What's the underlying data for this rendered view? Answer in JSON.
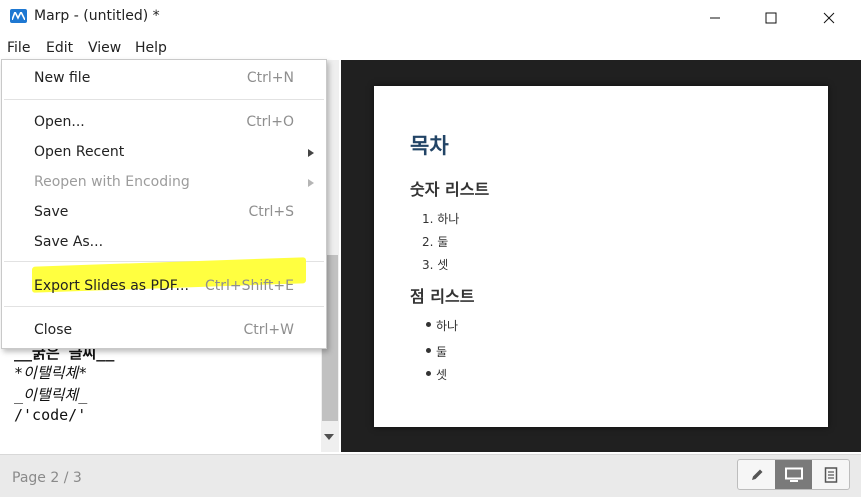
{
  "window": {
    "title": "Marp - (untitled) *",
    "icon": "marp-logo-icon"
  },
  "menubar": {
    "items": [
      "File",
      "Edit",
      "View",
      "Help"
    ]
  },
  "file_menu": {
    "items": [
      {
        "label": "New file",
        "shortcut": "Ctrl+N"
      },
      {
        "label": "Open...",
        "shortcut": "Ctrl+O"
      },
      {
        "label": "Open Recent",
        "submenu": true
      },
      {
        "label": "Reopen with Encoding",
        "submenu": true,
        "disabled": true
      },
      {
        "label": "Save",
        "shortcut": "Ctrl+S"
      },
      {
        "label": "Save As..."
      },
      {
        "label": "Export Slides as PDF...",
        "shortcut": "Ctrl+Shift+E",
        "highlighted": true
      },
      {
        "label": "Close",
        "shortcut": "Ctrl+W"
      }
    ],
    "highlight_color": "#ffff40"
  },
  "editor": {
    "lines": [
      "__굵은 글씨__",
      "*이탤릭체*",
      "_이탤릭체_",
      "/'code/'"
    ]
  },
  "slide": {
    "heading": "목차",
    "section1": "숫자 리스트",
    "ordered": [
      "1. 하나",
      "2. 둘",
      "3. 셋"
    ],
    "section2": "점 리스트",
    "bullets": [
      "하나",
      "둘",
      "셋"
    ],
    "heading_color": "#224466"
  },
  "status": {
    "page": "Page 2 / 3"
  },
  "view_modes": [
    "pencil-icon",
    "monitor-icon",
    "document-icon"
  ]
}
